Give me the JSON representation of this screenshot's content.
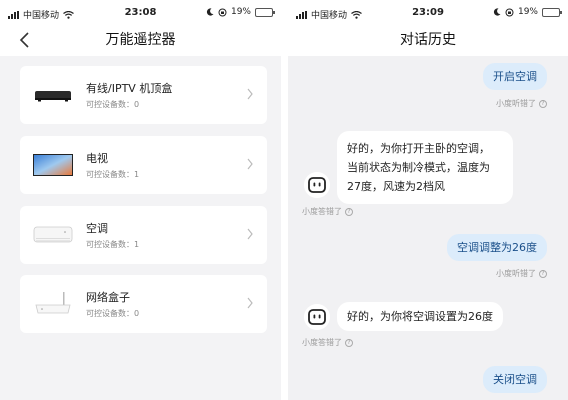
{
  "left": {
    "status": {
      "carrier": "中国移动",
      "time": "23:08",
      "battery": "19%"
    },
    "title": "万能遥控器",
    "devices": [
      {
        "name": "有线/IPTV 机顶盒",
        "count": "可控设备数：0",
        "icon": "set-top-box-icon"
      },
      {
        "name": "电视",
        "count": "可控设备数：1",
        "icon": "tv-icon"
      },
      {
        "name": "空调",
        "count": "可控设备数：1",
        "icon": "air-conditioner-icon"
      },
      {
        "name": "网络盒子",
        "count": "可控设备数：0",
        "icon": "network-box-icon"
      }
    ]
  },
  "right": {
    "status": {
      "carrier": "中国移动",
      "time": "23:09",
      "battery": "19%"
    },
    "title": "对话历史",
    "messages": [
      {
        "from": "user",
        "text": "开启空调",
        "feedback": "小度听错了"
      },
      {
        "from": "bot",
        "lines": [
          "好的，为你打开主卧的空调，",
          "当前状态为制冷模式，温度为",
          "27度，风速为2档风"
        ],
        "feedback": "小度答错了"
      },
      {
        "from": "user",
        "text": "空调调整为26度",
        "feedback": "小度听错了"
      },
      {
        "from": "bot",
        "lines": [
          "好的，为你将空调设置为26度"
        ],
        "feedback": "小度答错了"
      },
      {
        "from": "user",
        "text": "关闭空调"
      }
    ]
  },
  "colors": {
    "user_bubble": "#dcecfb",
    "user_text": "#1a4f8a",
    "battery_low": "#e02020"
  }
}
